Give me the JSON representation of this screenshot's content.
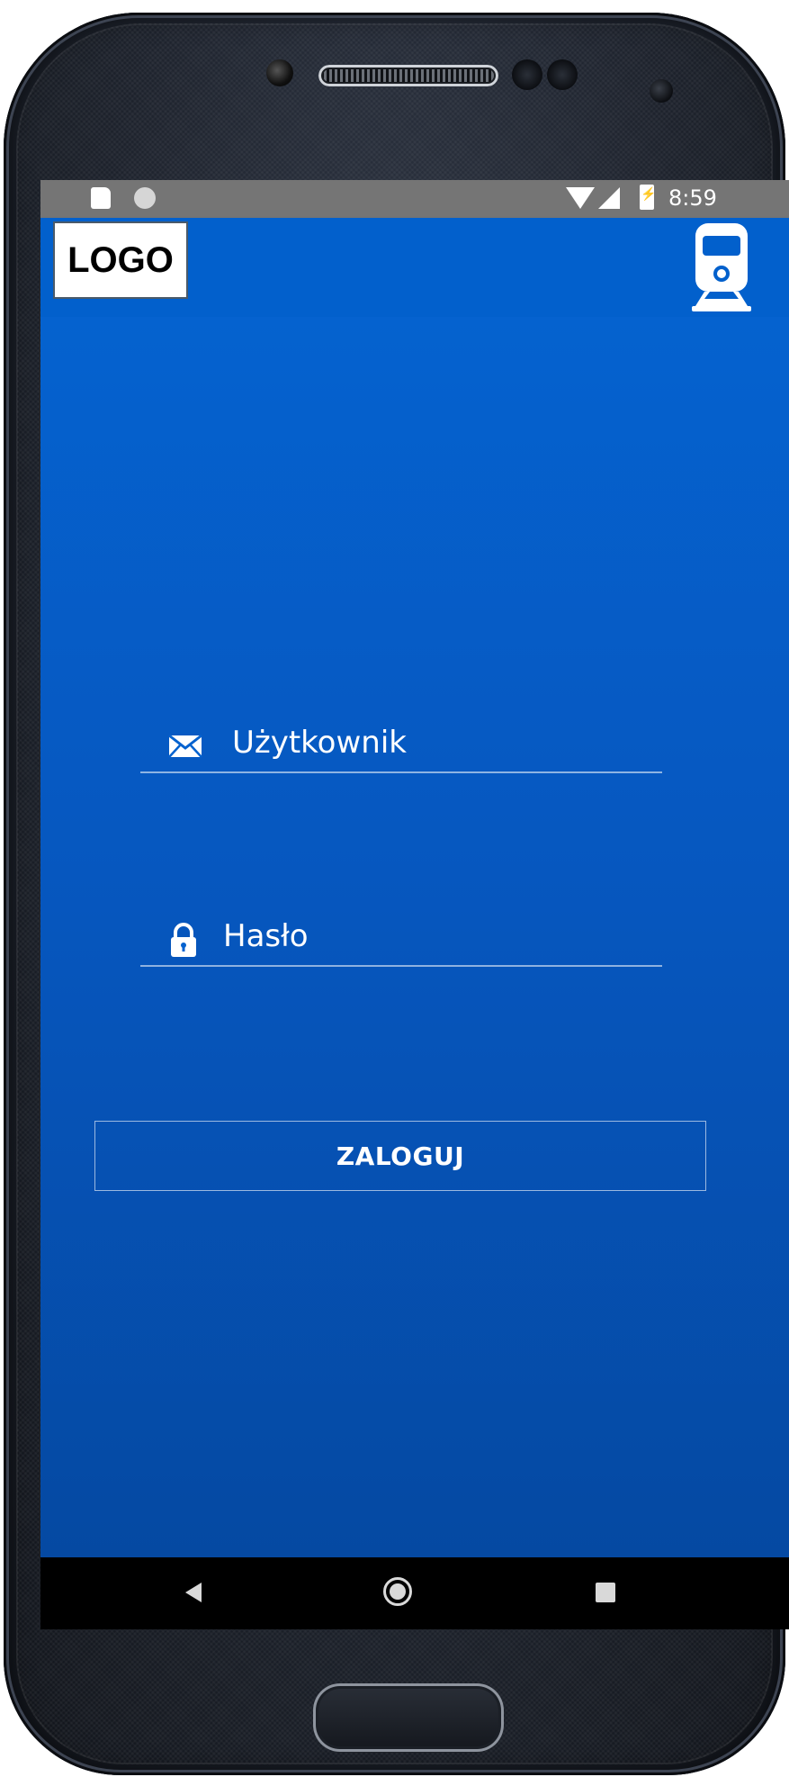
{
  "statusbar": {
    "time": "8:59"
  },
  "appbar": {
    "logo_text": "LOGO",
    "icon": "train-icon"
  },
  "form": {
    "username_placeholder": "Użytkownik",
    "password_placeholder": "Hasło",
    "login_label": "ZALOGUJ"
  },
  "icons": {
    "username": "mail-icon",
    "password": "lock-icon"
  },
  "colors": {
    "appbar": "#0260cc",
    "content_top": "#0562cf",
    "content_bottom": "#0549a2",
    "statusbar": "#757575",
    "navbar": "#000000"
  }
}
